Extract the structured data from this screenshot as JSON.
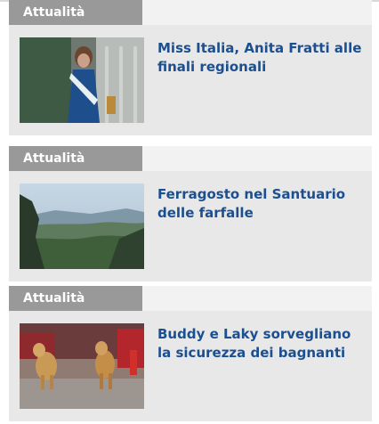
{
  "articles": [
    {
      "category": "Attualità",
      "title": "Ferragosto nel Santuario delle farfalle"
    },
    {
      "category": "Attualità",
      "title": "Buddy e Laky sorvegliano la sicurezza dei bagnanti"
    },
    {
      "category": "Attualità",
      "title": "Miss Italia, Anita Fratti alle finali regionali"
    }
  ],
  "colors": {
    "category_bg": "#999999",
    "category_bar_bg": "#f2f2f2",
    "card_bg": "#e8e8e8",
    "title": "#1c4f8f"
  }
}
